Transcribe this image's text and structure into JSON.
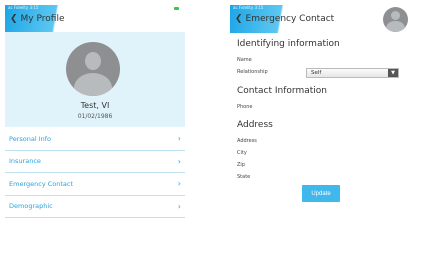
{
  "left": {
    "status_text": "ac Fidelity 3:15",
    "title": "My Profile",
    "profile": {
      "name": "Test, VI",
      "dob": "01/02/1986"
    },
    "menu": [
      {
        "label": "Personal Info"
      },
      {
        "label": "Insurance"
      },
      {
        "label": "Emergency Contact"
      },
      {
        "label": "Demographic"
      }
    ]
  },
  "right": {
    "status_text": "ac Fidelity 3:15",
    "title": "Emergency Contact",
    "sections": {
      "identifying": "Identifying information",
      "contact": "Contact Information",
      "address": "Address"
    },
    "fields": {
      "name": "Name",
      "relationship": "Relationship",
      "relationship_value": "Self",
      "phone": "Phone",
      "address": "Address",
      "city": "City",
      "zip": "Zip",
      "state": "State"
    },
    "update_label": "Update"
  },
  "colors": {
    "accent": "#2aa2dd",
    "profile_bg": "#e0f2fa",
    "button": "#40b8ec"
  }
}
